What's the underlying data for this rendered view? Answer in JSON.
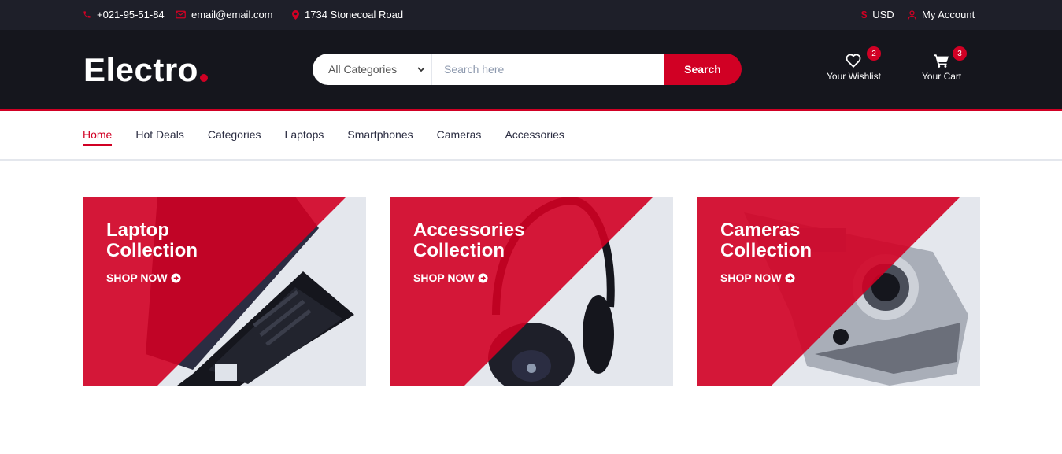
{
  "topbar": {
    "phone": "+021-95-51-84",
    "email": "email@email.com",
    "address": "1734 Stonecoal Road",
    "currency": "USD",
    "account": "My Account"
  },
  "header": {
    "logo": "Electro",
    "search": {
      "category_selected": "All Categories",
      "placeholder": "Search here",
      "button": "Search"
    },
    "wishlist": {
      "label": "Your Wishlist",
      "count": "2"
    },
    "cart": {
      "label": "Your Cart",
      "count": "3"
    }
  },
  "nav": {
    "items": [
      "Home",
      "Hot Deals",
      "Categories",
      "Laptops",
      "Smartphones",
      "Cameras",
      "Accessories"
    ]
  },
  "collections": [
    {
      "line1": "Laptop",
      "line2": "Collection",
      "cta": "SHOP NOW"
    },
    {
      "line1": "Accessories",
      "line2": "Collection",
      "cta": "SHOP NOW"
    },
    {
      "line1": "Cameras",
      "line2": "Collection",
      "cta": "SHOP NOW"
    }
  ],
  "colors": {
    "accent": "#d10024",
    "topbar_bg": "#1e1f29",
    "header_bg": "#15161d",
    "card_bg": "#e4e7ed"
  },
  "icons": {
    "phone": "phone-icon",
    "email": "envelope-icon",
    "address": "map-marker-icon",
    "currency": "dollar-icon",
    "account": "user-icon",
    "wishlist": "heart-icon",
    "cart": "shopping-cart-icon",
    "shop_now": "arrow-circle-right-icon"
  }
}
